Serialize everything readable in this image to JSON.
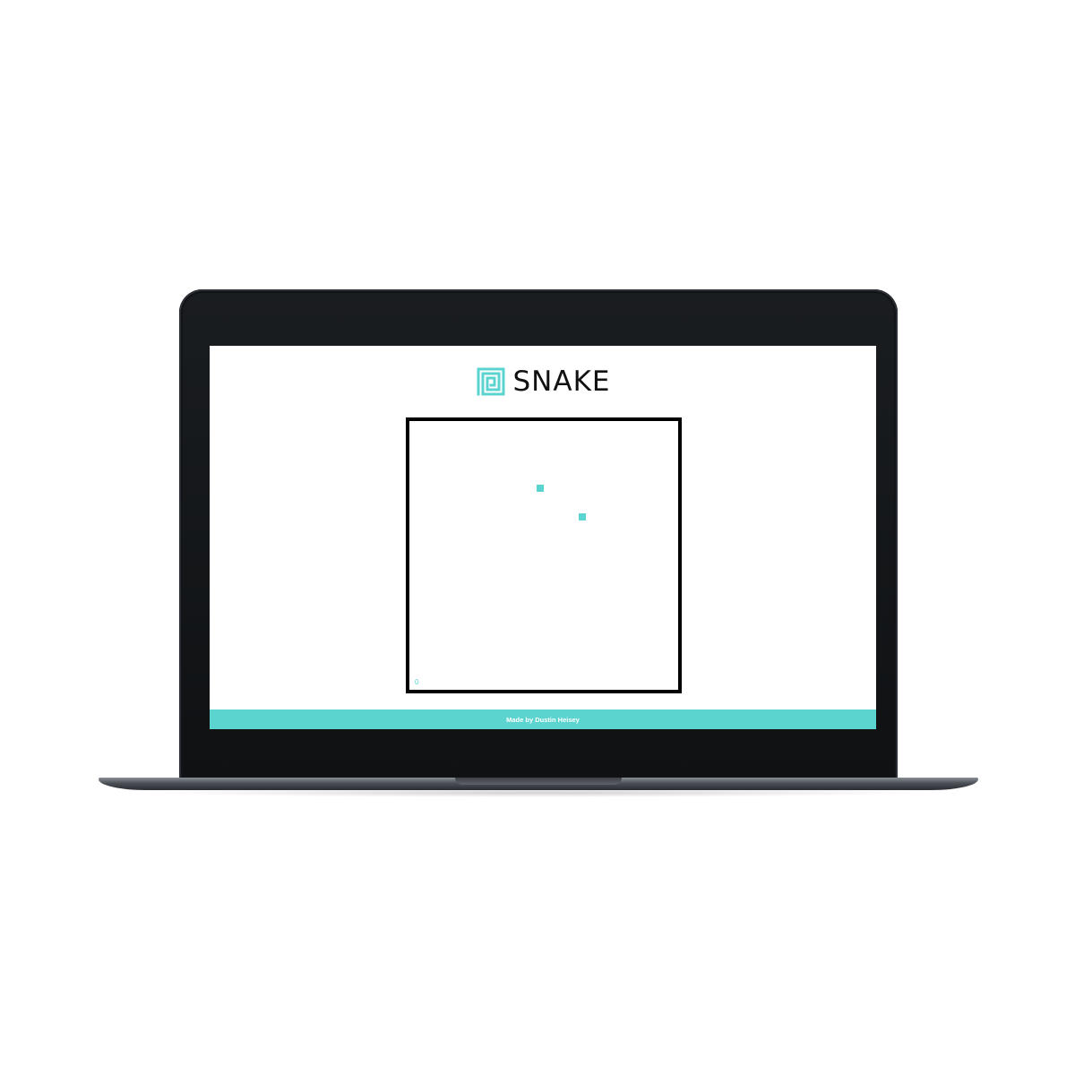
{
  "app": {
    "title": "SNAKE",
    "accent_color": "#5bd4d0",
    "logo_icon": "spiral-square-icon"
  },
  "game": {
    "score": "0",
    "grid_columns": 38,
    "grid_rows": 38,
    "snake_color": "#5bd4d0",
    "food_color": "#5bd4d0",
    "snake": [
      {
        "col": 18,
        "row": 9
      }
    ],
    "food": {
      "col": 24,
      "row": 13
    }
  },
  "footer": {
    "text": "Made by Dustin Heisey",
    "background": "#5bd4d0"
  }
}
